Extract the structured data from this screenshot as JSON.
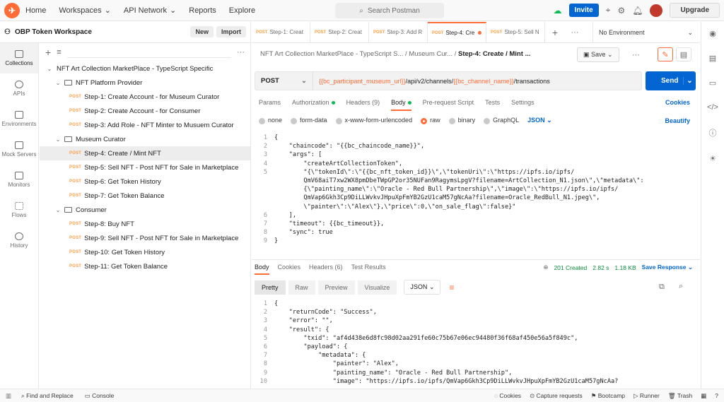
{
  "nav": {
    "home": "Home",
    "workspaces": "Workspaces",
    "api_network": "API Network",
    "reports": "Reports",
    "explore": "Explore",
    "search_placeholder": "Search Postman",
    "invite": "Invite",
    "upgrade": "Upgrade"
  },
  "workspace": {
    "name": "OBP Token Workspace",
    "new": "New",
    "import": "Import"
  },
  "rail": [
    {
      "label": "Collections"
    },
    {
      "label": "APIs"
    },
    {
      "label": "Environments"
    },
    {
      "label": "Mock Servers"
    },
    {
      "label": "Monitors"
    },
    {
      "label": "Flows"
    },
    {
      "label": "History"
    }
  ],
  "tree": {
    "collection": "NFT Art Collection MarketPlace - TypeScript Specific",
    "folders": [
      {
        "name": "NFT Platform Provider",
        "items": [
          "Step-1: Create Account - for Museum Curator",
          "Step-2: Create Account - for Consumer",
          "Step-3: Add Role - NFT Minter to Musuem Curator"
        ]
      },
      {
        "name": "Museum Curator",
        "items": [
          "Step-4: Create / Mint NFT",
          "Step-5: Sell NFT - Post NFT for Sale in Marketplace",
          "Step-6: Get Token History",
          "Step-7: Get Token Balance"
        ]
      },
      {
        "name": "Consumer",
        "items": [
          "Step-8: Buy NFT",
          "Step-9: Sell NFT - Post NFT for Sale in Marketplace",
          "Step-10: Get Token History",
          "Step-11: Get Token Balance"
        ]
      }
    ],
    "method": "POST"
  },
  "tabs": [
    {
      "method": "POST",
      "label": "Step-1: Creat"
    },
    {
      "method": "POST",
      "label": "Step-2: Creat"
    },
    {
      "method": "POST",
      "label": "Step-3: Add R"
    },
    {
      "method": "POST",
      "label": "Step-4: Cre"
    },
    {
      "method": "POST",
      "label": "Step-5: Sell N"
    }
  ],
  "environment": "No Environment",
  "request": {
    "crumb1": "NFT Art Collection MarketPlace - TypeScript S...",
    "crumb2": "Museum Cur...",
    "crumb3": "Step-4: Create / Mint ...",
    "save": "Save",
    "method": "POST",
    "url_var1": "{{bc_participant_museum_url}}",
    "url_mid": "/api/v2/channels/",
    "url_var2": "{{bc_channel_name}}",
    "url_end": "/transactions",
    "send": "Send",
    "tabs": [
      "Params",
      "Authorization",
      "Headers (9)",
      "Body",
      "Pre-request Script",
      "Tests",
      "Settings"
    ],
    "cookies": "Cookies",
    "body_opts": [
      "none",
      "form-data",
      "x-www-form-urlencoded",
      "raw",
      "binary",
      "GraphQL"
    ],
    "body_lang": "JSON",
    "beautify": "Beautify"
  },
  "body_lines": [
    {
      "n": "1",
      "t": "{"
    },
    {
      "n": "2",
      "t": "    \"chaincode\": \"{{bc_chaincode_name}}\","
    },
    {
      "n": "3",
      "t": "    \"args\": ["
    },
    {
      "n": "4",
      "t": "        \"createArtCollectionToken\","
    },
    {
      "n": "5",
      "t": "        \"{\\\"tokenId\\\":\\\"{{bc_nft_token_id}}\\\",\\\"tokenUri\\\":\\\"https://ipfs.io/ipfs/"
    },
    {
      "n": "",
      "t": "        QmV68aiT7xw2WX8pmDbeTWpGP2or35NUFan9RagymsLpgV?filename=ArtCollection_N1.json\\\",\\\"metadata\\\":"
    },
    {
      "n": "",
      "t": "        {\\\"painting_name\\\":\\\"Oracle - Red Bull Partnership\\\",\\\"image\\\":\\\"https://ipfs.io/ipfs/"
    },
    {
      "n": "",
      "t": "        QmVap6Gkh3Cp9DiLLWvkvJHpuXpFmYB2GzU1caM57gNcAa?filename=Oracle_RedBull_N1.jpeg\\\","
    },
    {
      "n": "",
      "t": "        \\\"painter\\\":\\\"Alex\\\"},\\\"price\\\":0,\\\"on_sale_flag\\\":false}\""
    },
    {
      "n": "6",
      "t": "    ],"
    },
    {
      "n": "7",
      "t": "    \"timeout\": {{bc_timeout}},"
    },
    {
      "n": "8",
      "t": "    \"sync\": true"
    },
    {
      "n": "9",
      "t": "}"
    }
  ],
  "response": {
    "tabs": [
      "Body",
      "Cookies",
      "Headers (6)",
      "Test Results"
    ],
    "status": "201 Created",
    "time": "2.82 s",
    "size": "1.18 KB",
    "save": "Save Response",
    "views": [
      "Pretty",
      "Raw",
      "Preview",
      "Visualize"
    ],
    "lang": "JSON"
  },
  "resp_lines": [
    {
      "n": "1",
      "t": "{"
    },
    {
      "n": "2",
      "t": "    \"returnCode\": \"Success\","
    },
    {
      "n": "3",
      "t": "    \"error\": \"\","
    },
    {
      "n": "4",
      "t": "    \"result\": {"
    },
    {
      "n": "5",
      "t": "        \"txid\": \"af4d438e6d8fc98d02aa291fe60c75b67e06ec94480f36f68af450e56a5f849c\","
    },
    {
      "n": "6",
      "t": "        \"payload\": {"
    },
    {
      "n": "7",
      "t": "            \"metadata\": {"
    },
    {
      "n": "8",
      "t": "                \"painter\": \"Alex\","
    },
    {
      "n": "9",
      "t": "                \"painting_name\": \"Oracle - Red Bull Partnership\","
    },
    {
      "n": "10",
      "t": "                \"image\": \"https://ipfs.io/ipfs/QmVap6Gkh3Cp9DiLLWvkvJHpuXpFmYB2GzU1caM57gNcAa?"
    }
  ],
  "statusbar": {
    "find": "Find and Replace",
    "console": "Console",
    "cookies": "Cookies",
    "capture": "Capture requests",
    "bootcamp": "Bootcamp",
    "runner": "Runner",
    "trash": "Trash"
  }
}
